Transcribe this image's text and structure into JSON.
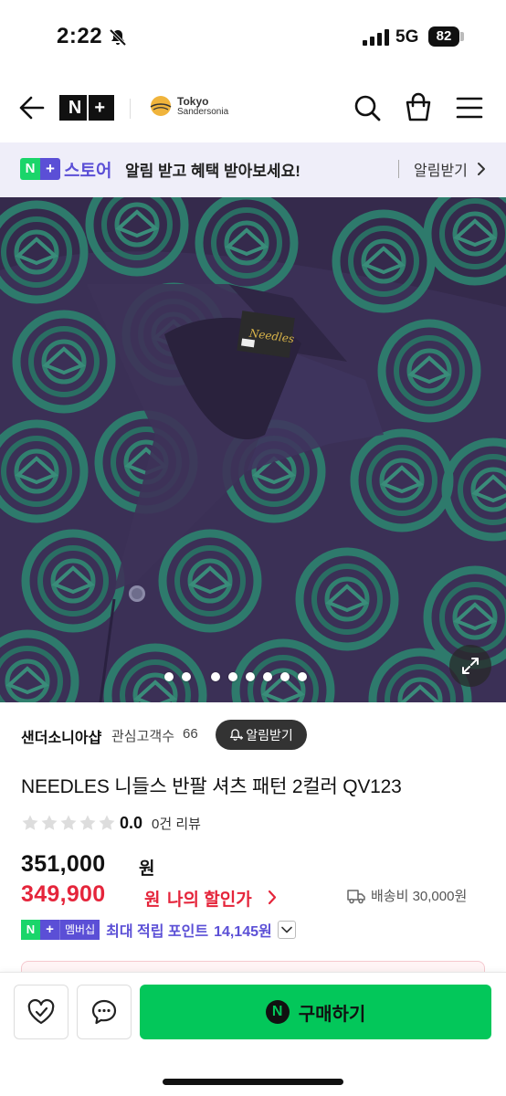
{
  "status_bar": {
    "time": "2:22",
    "network": "5G",
    "battery": "82"
  },
  "header": {
    "logo_text": "N",
    "logo_plus": "+",
    "store_line1": "Tokyo",
    "store_line2": "Sandersonia"
  },
  "promo": {
    "badge_n": "N",
    "badge_plus": "+",
    "store_label": "스토어",
    "message": "알림 받고 혜택 받아보세요!",
    "link_label": "알림받기"
  },
  "gallery": {
    "total_images": 9,
    "current_index": 0
  },
  "store": {
    "name": "샌더소니아샵",
    "fan_label": "관심고객수",
    "fan_count": "66",
    "notify_button": "알림받기"
  },
  "product": {
    "title": "NEEDLES 니들스 반팔 셔츠 패턴 2컬러 QV123",
    "rating": "0.0",
    "review_count": "0건 리뷰",
    "price_original": "351,000",
    "price_unit": "원",
    "price_sale": "349,900",
    "my_discount_label": "나의 할인가",
    "shipping": "배송비 30,000원"
  },
  "points": {
    "badge_n": "N",
    "badge_plus": "+",
    "membership_label": "멤버십",
    "label": "최대 적립 포인트",
    "value": "14,145원"
  },
  "bottom_bar": {
    "buy_label": "구매하기",
    "buy_icon": "N"
  },
  "colors": {
    "naver_green": "#03c75a",
    "plus_purple": "#5b4fd6",
    "sale_red": "#e5253b",
    "promo_bg": "#efeef9"
  }
}
